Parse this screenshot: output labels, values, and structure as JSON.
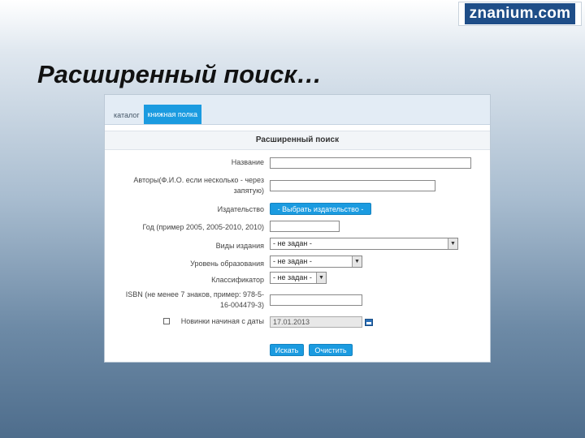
{
  "logo": {
    "text": "znanium.com"
  },
  "slide": {
    "title": "Расширенный поиск…"
  },
  "tabs": [
    {
      "label": "каталог",
      "active": false
    },
    {
      "label": "книжная полка",
      "active": true
    }
  ],
  "form": {
    "header": "Расширенный поиск",
    "fields": {
      "title": {
        "label": "Название",
        "value": ""
      },
      "authors": {
        "label_line1": "Авторы(Ф.И.О. если несколько - через",
        "label_line2": "запятую)",
        "value": ""
      },
      "publisher": {
        "label": "Издательство",
        "button": "- Выбрать издательство -"
      },
      "year": {
        "label": "Год (пример 2005, 2005-2010, 2010)",
        "value": ""
      },
      "type": {
        "label": "Виды издания",
        "selected": "- не задан -"
      },
      "level": {
        "label": "Уровень образования",
        "selected": "- не задан -"
      },
      "classifier": {
        "label": "Классификатор",
        "selected": "- не задан -"
      },
      "isbn": {
        "label_line1": "ISBN (не менее 7 знаков, пример: 978-5-",
        "label_line2": "16-004479-3)",
        "value": ""
      },
      "novelties": {
        "label": "Новинки начиная с даты",
        "checked": false,
        "date": "17.01.2013"
      }
    },
    "buttons": {
      "search": "Искать",
      "clear": "Очистить"
    }
  },
  "colors": {
    "accent": "#1b9be0",
    "logo_bg": "#1f4e88"
  }
}
